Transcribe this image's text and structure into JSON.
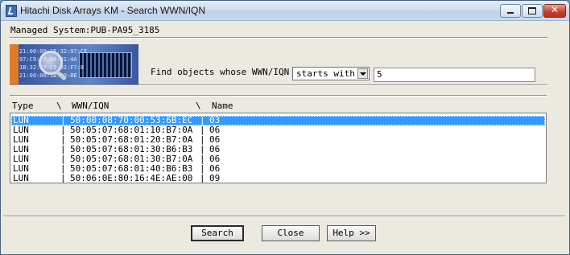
{
  "window": {
    "title": "Hitachi Disk Arrays KM - Search WWN/IQN",
    "close_glyph": "✕"
  },
  "managed_system": {
    "text": "Managed System:PUB-PA95_3185"
  },
  "banner": {
    "hex_lines": [
      "21:00:00:1E:32:97:CE",
      "97:C9:F7:8A:31:4A",
      "1B:32:97:C9:02:F7:8",
      "21:00:00:1B:30:BE"
    ]
  },
  "search": {
    "label": "Find objects whose WWN/IQN",
    "mode": "starts with",
    "value": "5"
  },
  "table": {
    "headers": {
      "type": "Type",
      "sep1": "\\",
      "wwn": "WWN/IQN",
      "sep2": "\\",
      "name": "Name"
    },
    "rows": [
      {
        "type": "LUN",
        "sep1": "|",
        "wwn": "50:00:08:70:00:53:6B:EC",
        "sep2": "|",
        "name": "03"
      },
      {
        "type": "LUN",
        "sep1": "|",
        "wwn": "50:05:07:68:01:10:B7:0A",
        "sep2": "|",
        "name": "06"
      },
      {
        "type": "LUN",
        "sep1": "|",
        "wwn": "50:05:07:68:01:20:B7:0A",
        "sep2": "|",
        "name": "06"
      },
      {
        "type": "LUN",
        "sep1": "|",
        "wwn": "50:05:07:68:01:30:B6:B3",
        "sep2": "|",
        "name": "06"
      },
      {
        "type": "LUN",
        "sep1": "|",
        "wwn": "50:05:07:68:01:30:B7:0A",
        "sep2": "|",
        "name": "06"
      },
      {
        "type": "LUN",
        "sep1": "|",
        "wwn": "50:05:07:68:01:40:B6:B3",
        "sep2": "|",
        "name": "06"
      },
      {
        "type": "LUN",
        "sep1": "|",
        "wwn": "50:06:0E:80:16:4E:AE:00",
        "sep2": "|",
        "name": "09"
      }
    ],
    "selected_row": 0
  },
  "buttons": {
    "search": "Search",
    "close": "Close",
    "help": "Help >>"
  }
}
